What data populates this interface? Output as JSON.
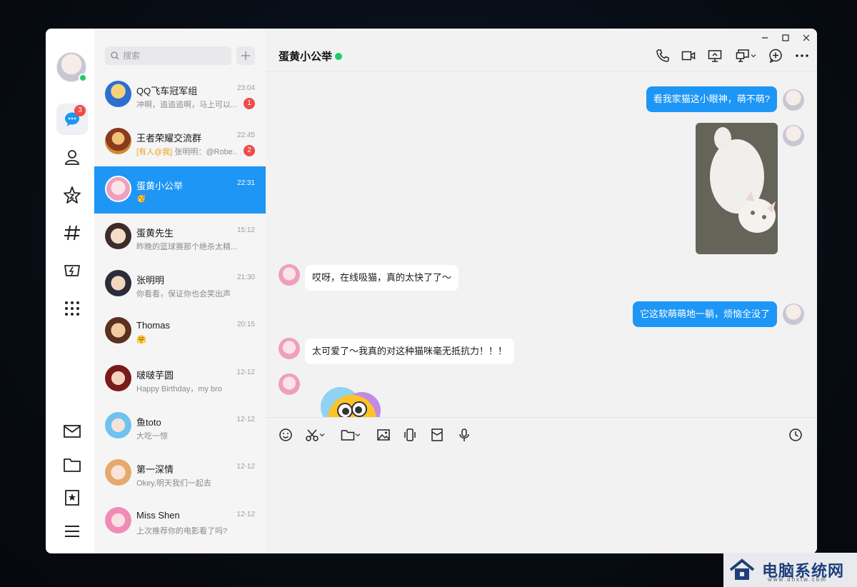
{
  "window_controls": {
    "minimize": "–",
    "maximize": "□",
    "close": "×"
  },
  "rail": {
    "message_badge": "3",
    "icons": [
      "chat-icon",
      "contacts-icon",
      "star-icon",
      "channel-icon",
      "games-icon",
      "apps-grid-icon",
      "mail-icon",
      "folder-icon",
      "favorites-icon",
      "menu-icon"
    ]
  },
  "search": {
    "placeholder": "搜索"
  },
  "sessions": [
    {
      "name": "QQ飞车冠军组",
      "time": "23:04",
      "preview": "冲啊，追追追啊，马上可以...",
      "badge": "1"
    },
    {
      "name": "王者荣耀交流群",
      "time": "22:45",
      "mention": "[有人@我]",
      "preview": " 张明明：@Robe...",
      "badge": "2"
    },
    {
      "name": "蛋黄小公举",
      "time": "22:31",
      "preview": "🥳"
    },
    {
      "name": "蛋黄先生",
      "time": "15:12",
      "preview": "昨晚的篮球赛那个绝杀太精..."
    },
    {
      "name": "张明明",
      "time": "21:30",
      "preview": "你看看，保证你也会笑出声"
    },
    {
      "name": "Thomas",
      "time": "20:15",
      "preview": "🤗"
    },
    {
      "name": "啵啵芋圆",
      "time": "12-12",
      "preview": "Happy Birthday，my bro"
    },
    {
      "name": "鱼toto",
      "time": "12-12",
      "preview": "大吃一惊"
    },
    {
      "name": "第一深情",
      "time": "12-12",
      "preview": "Okey,明天我们一起去"
    },
    {
      "name": "Miss Shen",
      "time": "12-12",
      "preview": "上次推荐你的电影看了吗?"
    }
  ],
  "chat": {
    "title": "蛋黄小公举",
    "messages": [
      {
        "from": "me",
        "text": "看我家猫这小眼神，萌不萌?"
      },
      {
        "from": "me",
        "type": "image",
        "alt": "cat photo"
      },
      {
        "from": "other",
        "text": "哎呀，在线吸猫，真的太快了了～"
      },
      {
        "from": "me",
        "text": "它这软萌萌地一躺，烦恼全没了"
      },
      {
        "from": "other",
        "text": "太可爱了～我真的对这种猫咪毫无抵抗力！！！"
      },
      {
        "from": "other",
        "type": "sticker"
      }
    ],
    "header_icons": [
      "phone-icon",
      "video-icon",
      "screen-share-icon",
      "remote-assist-icon",
      "add-icon",
      "more-icon"
    ],
    "composer_icons": [
      "emoji-icon",
      "screenshot-icon",
      "file-icon",
      "image-icon",
      "shake-icon",
      "redpacket-icon",
      "voice-icon",
      "history-icon"
    ]
  },
  "watermark": {
    "title": "电脑系统网",
    "url": "www.dnxtw.com"
  },
  "colors": {
    "accent": "#1d96f5",
    "online": "#1ecb6b",
    "badge": "#f14b4b"
  }
}
